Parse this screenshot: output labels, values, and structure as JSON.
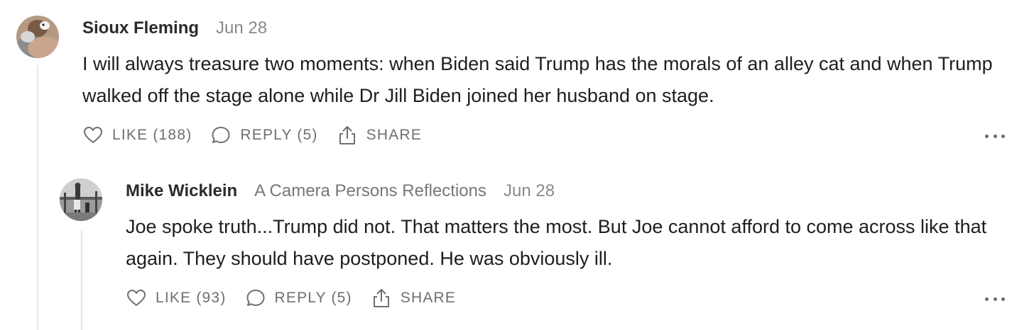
{
  "comment": {
    "author": "Sioux Fleming",
    "date": "Jun 28",
    "body": "I will always treasure two moments: when Biden said Trump has the morals of an alley cat and when Trump walked off the stage alone while Dr Jill Biden joined her husband on stage.",
    "like_label": "LIKE (188)",
    "reply_label": "REPLY (5)",
    "share_label": "SHARE"
  },
  "reply": {
    "author": "Mike Wicklein",
    "publication": "A Camera Persons Reflections",
    "date": "Jun 28",
    "body": "Joe spoke truth...Trump did not. That matters the most. But Joe cannot afford to come across like that again. They should have postponed. He was obviously ill.",
    "like_label": "LIKE (93)",
    "reply_label": "REPLY (5)",
    "share_label": "SHARE"
  },
  "icons": {
    "like": "heart-icon",
    "reply": "speech-bubble-icon",
    "share": "share-upload-icon",
    "more": "ellipsis-icon"
  },
  "colors": {
    "text": "#1e1e1e",
    "muted": "#6f6f6f",
    "thread_line": "#e5e5e5"
  }
}
